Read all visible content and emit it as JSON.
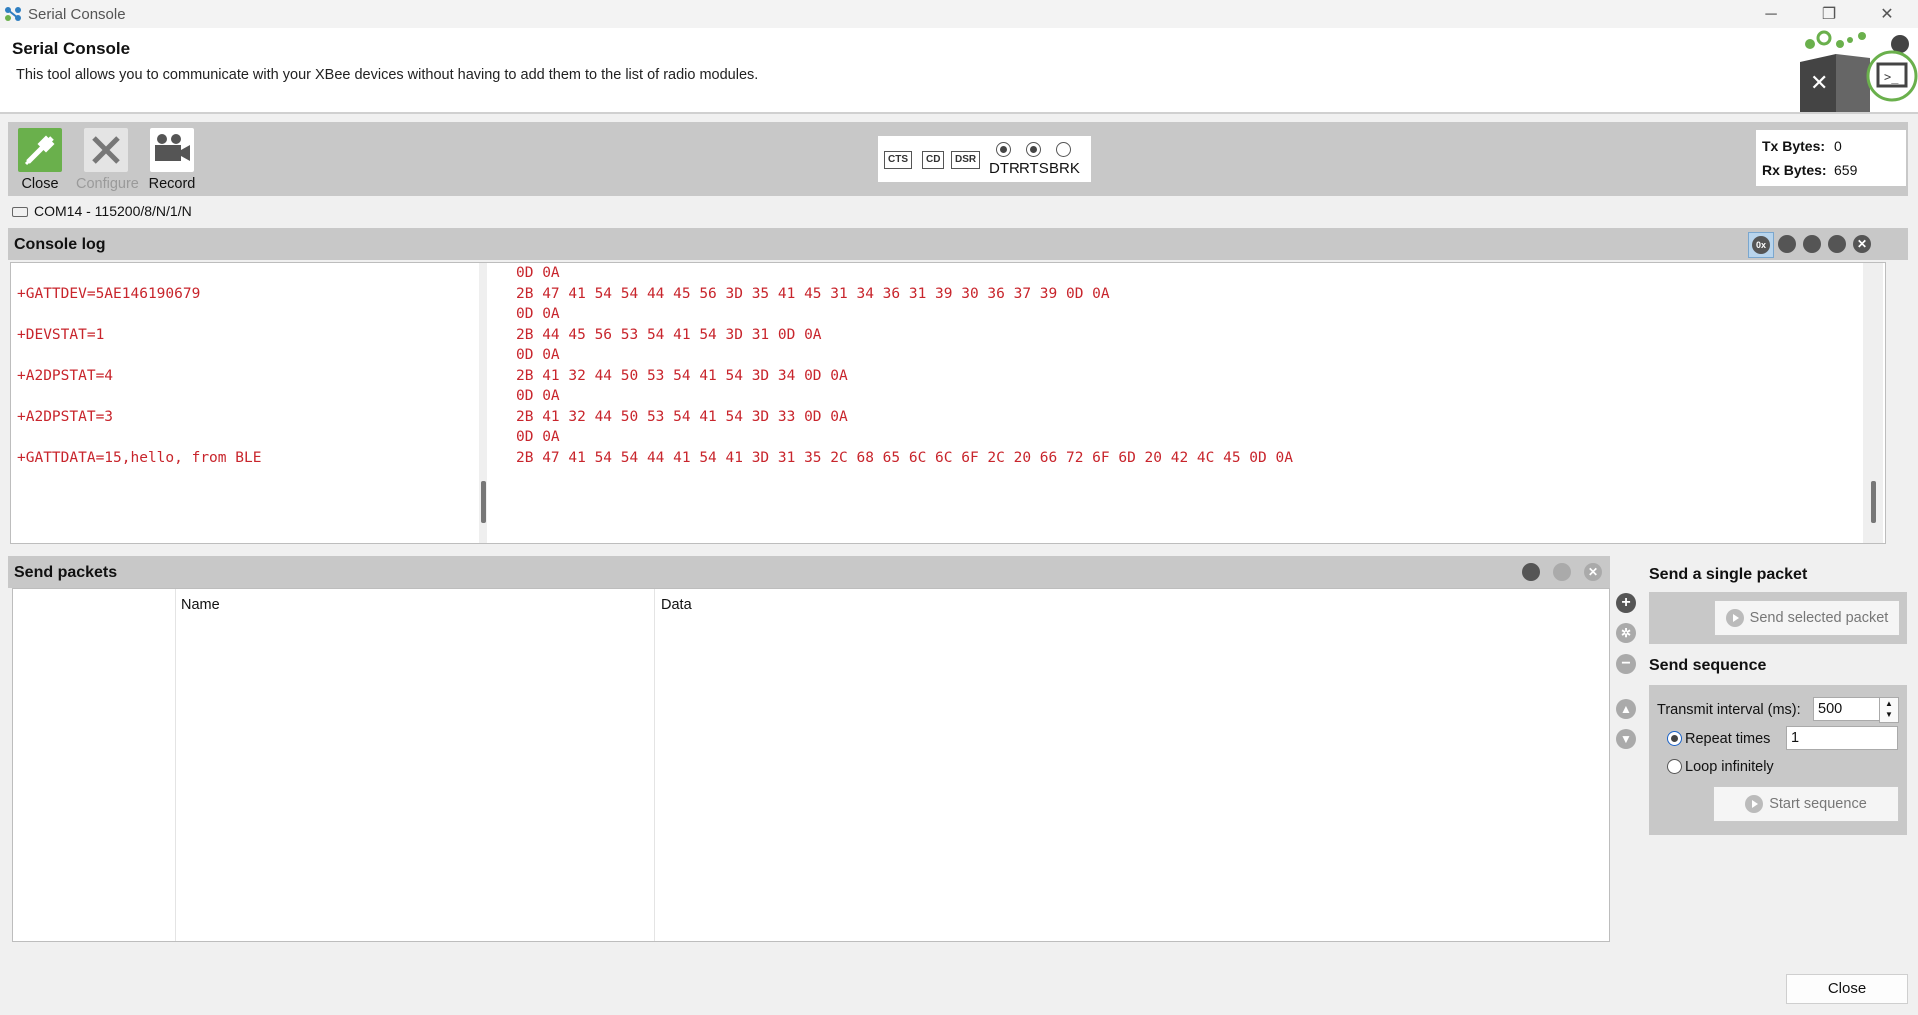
{
  "window": {
    "title": "Serial Console"
  },
  "header": {
    "title": "Serial Console",
    "description": "This tool allows you to communicate with your XBee devices without having to add them to the list of radio modules."
  },
  "toolbar": {
    "close_label": "Close",
    "configure_label": "Configure",
    "record_label": "Record",
    "flow_badges": [
      "CTS",
      "CD",
      "DSR"
    ],
    "dtr_label": "DTR",
    "rts_label": "RTS",
    "brk_label": "BRK",
    "dtr_on": true,
    "rts_on": true,
    "brk_on": false,
    "tx_label": "Tx Bytes:",
    "tx_value": "0",
    "rx_label": "Rx Bytes:",
    "rx_value": "659"
  },
  "port": {
    "description": "COM14 - 115200/8/N/1/N"
  },
  "console": {
    "title": "Console log",
    "ascii_lines": [
      "",
      "+GATTDEV=5AE146190679",
      "",
      "+DEVSTAT=1",
      "",
      "+A2DPSTAT=4",
      "",
      "+A2DPSTAT=3",
      "",
      "+GATTDATA=15,hello, from BLE"
    ],
    "hex_lines": [
      "0D 0A",
      "2B 47 41 54 54 44 45 56 3D 35 41 45 31 34 36 31 39 30 36 37 39 0D 0A",
      "0D 0A",
      "2B 44 45 56 53 54 41 54 3D 31 0D 0A",
      "0D 0A",
      "2B 41 32 44 50 53 54 41 54 3D 34 0D 0A",
      "0D 0A",
      "2B 41 32 44 50 53 54 41 54 3D 33 0D 0A",
      "0D 0A",
      "2B 47 41 54 54 44 41 54 41 3D 31 35 2C 68 65 6C 6C 6F 2C 20 66 72 6F 6D 20 42 4C 45 0D 0A"
    ],
    "hex_mode_icon": "0x"
  },
  "send_packets": {
    "title": "Send packets",
    "columns": [
      "",
      "Name",
      "Data"
    ]
  },
  "single_packet": {
    "title": "Send a single packet",
    "button": "Send selected packet"
  },
  "sequence": {
    "title": "Send sequence",
    "interval_label": "Transmit interval (ms):",
    "interval_value": "500",
    "repeat_label": "Repeat times",
    "repeat_value": "1",
    "loop_label": "Loop infinitely",
    "button": "Start sequence"
  },
  "footer": {
    "close_label": "Close"
  },
  "colors": {
    "console_text": "#c8252c",
    "accent_green": "#6ab04c",
    "panel_gray": "#c8c8c8"
  }
}
